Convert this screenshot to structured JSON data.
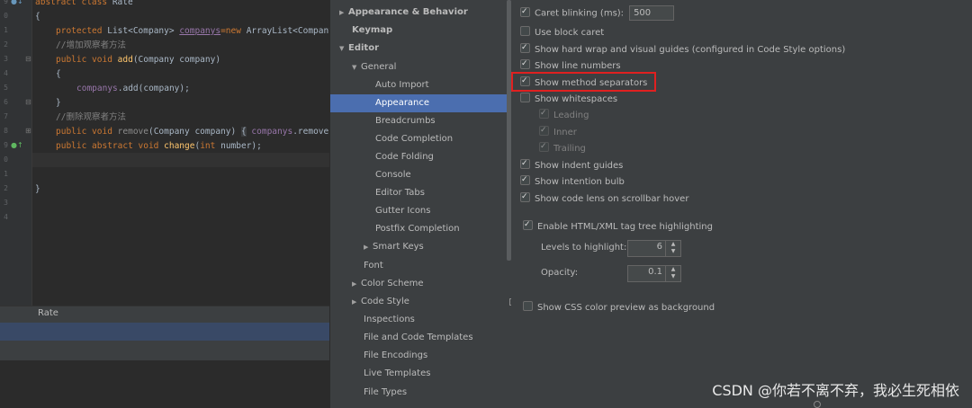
{
  "editor": {
    "line_numbers": [
      "9",
      "0",
      "1",
      "2",
      "3",
      "4",
      "5",
      "6",
      "7",
      "8",
      "9",
      "0",
      "1",
      "2",
      "3",
      "4"
    ],
    "lines": {
      "l0": {
        "kw": "abstract class",
        "name": "Rate"
      },
      "l1": {
        "text": "{"
      },
      "l2": {
        "kw": "protected",
        "type": "List<Company>",
        "field": "companys",
        "rest_kw": "=new",
        "rest": "ArrayList<Company"
      },
      "l3": {
        "comment": "//增加观察者方法"
      },
      "l4": {
        "kw": "public void",
        "fn": "add",
        "params": "(Company company)"
      },
      "l5": {
        "text": "{"
      },
      "l6": {
        "field": "companys",
        "call": ".add(company);"
      },
      "l7": {
        "text": "}"
      },
      "l8": {
        "comment": "//删除观察者方法"
      },
      "l9": {
        "kw": "public void",
        "fn": "remove",
        "params": "(Company company)",
        "fold": "{",
        "field": "companys",
        "call": ".remove("
      },
      "l10": {
        "kw": "public abstract void",
        "fn": "change",
        "params_open": "(",
        "param_kw": "int",
        "params_close": "number);"
      },
      "l11": {
        "text": "}"
      }
    },
    "file_tab_label": "Rate"
  },
  "tree": {
    "items": [
      {
        "label": "Appearance & Behavior",
        "arrow": "▶"
      },
      {
        "label": "Keymap"
      },
      {
        "label": "Editor",
        "arrow": "▼"
      },
      {
        "label": "General",
        "arrow": "▼"
      },
      {
        "label": "Auto Import"
      },
      {
        "label": "Appearance"
      },
      {
        "label": "Breadcrumbs"
      },
      {
        "label": "Code Completion"
      },
      {
        "label": "Code Folding"
      },
      {
        "label": "Console"
      },
      {
        "label": "Editor Tabs"
      },
      {
        "label": "Gutter Icons"
      },
      {
        "label": "Postfix Completion"
      },
      {
        "label": "Smart Keys",
        "arrow": "▶"
      },
      {
        "label": "Font"
      },
      {
        "label": "Color Scheme",
        "arrow": "▶"
      },
      {
        "label": "Code Style",
        "arrow": "▶"
      },
      {
        "label": "Inspections"
      },
      {
        "label": "File and Code Templates"
      },
      {
        "label": "File Encodings"
      },
      {
        "label": "Live Templates"
      },
      {
        "label": "File Types"
      }
    ]
  },
  "panel": {
    "caret_blinking_label": "Caret blinking (ms):",
    "caret_blinking_value": "500",
    "use_block_caret": "Use block caret",
    "show_hard_wrap": "Show hard wrap and visual guides (configured in Code Style options)",
    "show_line_numbers": "Show line numbers",
    "show_method_separators": "Show method separators",
    "show_whitespaces": "Show whitespaces",
    "leading": "Leading",
    "inner": "Inner",
    "trailing": "Trailing",
    "show_indent_guides": "Show indent guides",
    "show_intention_bulb": "Show intention bulb",
    "show_code_lens": "Show code lens on scrollbar hover",
    "enable_tag_tree": "Enable HTML/XML tag tree highlighting",
    "levels_label": "Levels to highlight:",
    "levels_value": "6",
    "opacity_label": "Opacity:",
    "opacity_value": "0.1",
    "show_css_preview": "Show CSS color preview as background"
  },
  "watermark": "CSDN @你若不离不弃，我必生死相依",
  "colors": {
    "selection": "#4b6eaf",
    "highlight_box": "#e02020"
  }
}
